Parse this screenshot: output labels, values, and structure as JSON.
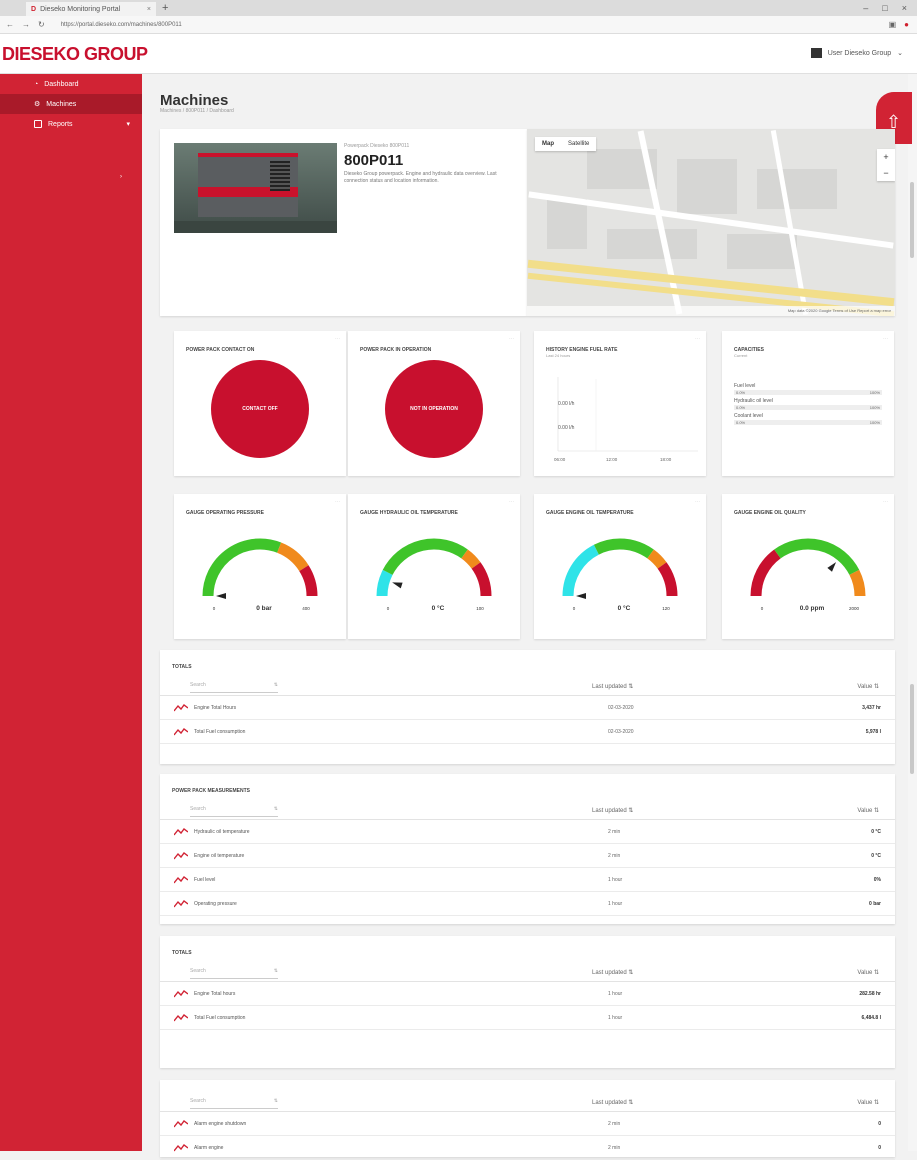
{
  "browser": {
    "tab_title": "Dieseko Monitoring Portal",
    "new_tab": "+",
    "url": "https://portal.dieseko.com/machines/800P011",
    "window_controls": [
      "–",
      "□",
      "×"
    ]
  },
  "header": {
    "logo": "DIESEKO GROUP",
    "user_name": "User Dieseko Group"
  },
  "sidebar": {
    "items": [
      {
        "label": "Dashboard"
      },
      {
        "label": "Machines"
      },
      {
        "label": "Reports"
      }
    ]
  },
  "page": {
    "title": "Machines",
    "breadcrumb": "Machines / 800P011 / Dashboard"
  },
  "machine": {
    "subtitle": "Powerpack Dieseko 800P011",
    "name": "800P011",
    "description": "Dieseko Group powerpack. Engine and hydraulic data overview. Last connection status and location information."
  },
  "map": {
    "tabs": [
      "Map",
      "Satellite"
    ],
    "zoom_in": "+",
    "zoom_out": "−",
    "footer": "Map data ©2020 Google  Terms of Use  Report a map error"
  },
  "widgets": {
    "contact": {
      "title": "POWER PACK CONTACT ON",
      "status": "CONTACT OFF"
    },
    "operation": {
      "title": "POWER PACK IN OPERATION",
      "status": "NOT IN OPERATION"
    },
    "history": {
      "title": "HISTORY ENGINE FUEL RATE",
      "subtitle": "Last 24 hours",
      "ylabels": [
        "0.00 l/h",
        "0.00 l/h"
      ],
      "xlabels": [
        "06:00",
        "12:00",
        "18:00"
      ]
    },
    "capacities": {
      "title": "CAPACITIES",
      "subtitle": "Current",
      "rows": [
        {
          "label": "Fuel level",
          "value": "0.0%",
          "max": "100%"
        },
        {
          "label": "Hydraulic oil level",
          "value": "0.0%",
          "max": "100%"
        },
        {
          "label": "Coolant level",
          "value": "0.0%",
          "max": "100%"
        }
      ]
    }
  },
  "gauges": [
    {
      "title": "GAUGE OPERATING PRESSURE",
      "value": "0 bar",
      "min": "0",
      "max": "400",
      "value_frac": 0.0
    },
    {
      "title": "GAUGE HYDRAULIC OIL TEMPERATURE",
      "value": "0 °C",
      "min": "0",
      "max": "100",
      "value_frac": 0.1
    },
    {
      "title": "GAUGE ENGINE OIL TEMPERATURE",
      "value": "0 °C",
      "min": "0",
      "max": "120",
      "value_frac": 0.0
    },
    {
      "title": "GAUGE ENGINE OIL QUALITY",
      "value": "0.0 ppm",
      "min": "0",
      "max": "2000",
      "value_frac": 0.72
    }
  ],
  "tables": [
    {
      "title": "TOTALS",
      "search_placeholder": "Search",
      "col_updated": "Last updated",
      "col_value": "Value",
      "rows": [
        {
          "name": "Engine Total Hours",
          "updated": "02-03-2020",
          "value": "3,437 hr"
        },
        {
          "name": "Total Fuel consumption",
          "updated": "02-03-2020",
          "value": "5,978 l"
        }
      ]
    },
    {
      "title": "POWER PACK MEASUREMENTS",
      "search_placeholder": "Search",
      "col_updated": "Last updated",
      "col_value": "Value",
      "rows": [
        {
          "name": "Hydraulic oil temperature",
          "updated": "2 min",
          "value": "0 °C"
        },
        {
          "name": "Engine oil temperature",
          "updated": "2 min",
          "value": "0 °C"
        },
        {
          "name": "Fuel level",
          "updated": "1 hour",
          "value": "0%"
        },
        {
          "name": "Operating pressure",
          "updated": "1 hour",
          "value": "0 bar"
        }
      ]
    },
    {
      "title": "TOTALS",
      "search_placeholder": "Search",
      "col_updated": "Last updated",
      "col_value": "Value",
      "rows": [
        {
          "name": "Engine Total hours",
          "updated": "1 hour",
          "value": "282.58 hr"
        },
        {
          "name": "Total Fuel consumption",
          "updated": "1 hour",
          "value": "6,484.8 l"
        }
      ]
    },
    {
      "title": "",
      "search_placeholder": "Search",
      "col_updated": "Last updated",
      "col_value": "Value",
      "rows": [
        {
          "name": "Alarm engine shutdown",
          "updated": "2 min",
          "value": "0"
        },
        {
          "name": "Alarm engine",
          "updated": "2 min",
          "value": "0"
        }
      ]
    }
  ],
  "colors": {
    "brand": "#d12334",
    "green": "#3fc42a",
    "orange": "#f08a1c",
    "red": "#c8102e",
    "cyan": "#2fe3e8"
  }
}
